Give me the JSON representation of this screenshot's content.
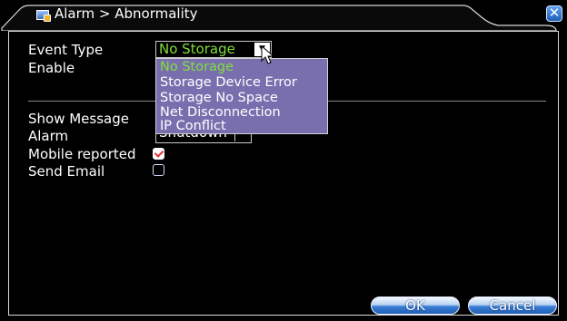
{
  "window": {
    "title": "Alarm > Abnormality"
  },
  "form": {
    "event_type_label": "Event Type",
    "event_type_value": "No Storage",
    "enable_label": "Enable",
    "show_message_label": "Show Message",
    "alarm_label": "Alarm",
    "alarm_value": "Shutdown",
    "mobile_reported_label": "Mobile reported",
    "mobile_reported_checked": true,
    "send_email_label": "Send Email",
    "send_email_checked": false
  },
  "dropdown": {
    "options": [
      "No Storage",
      "Storage Device Error",
      "Storage No Space",
      "Net Disconnection",
      "IP Conflict"
    ],
    "selected": "No Storage"
  },
  "buttons": {
    "ok": "OK",
    "cancel": "Cancel"
  },
  "icons": {
    "title": "alarm-window-icon",
    "close": "close-icon",
    "cursor": "mouse-pointer-icon"
  },
  "colors": {
    "selected_text": "#7fdf3a",
    "dropdown_bg": "#7a6fae",
    "check_mark": "#e23030"
  }
}
